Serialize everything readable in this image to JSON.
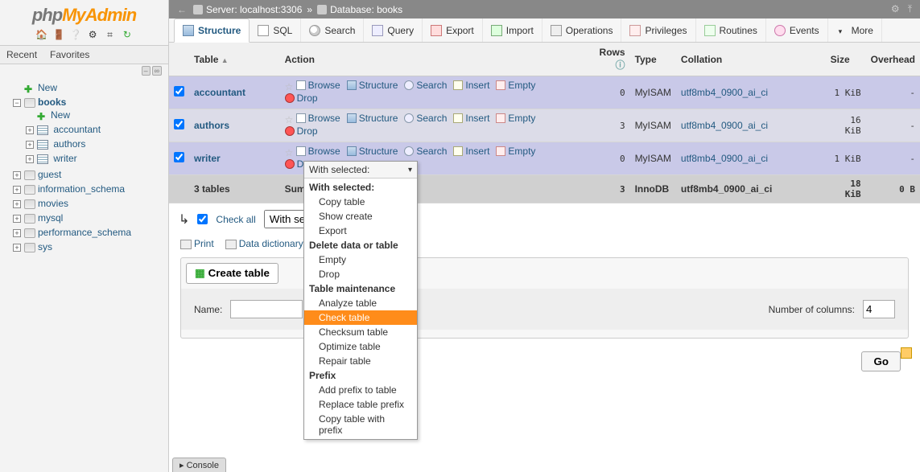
{
  "logo": {
    "p1": "php",
    "p2": "My",
    "p3": "Admin"
  },
  "left_toolbar_icons": [
    "home",
    "logout",
    "docs",
    "gear",
    "gear2",
    "refresh"
  ],
  "recent_fav": {
    "recent": "Recent",
    "favorites": "Favorites"
  },
  "tree": {
    "new_label": "New",
    "databases": [
      {
        "name": "books",
        "expanded": true,
        "selected": true,
        "children": [
          {
            "name": "New",
            "type": "new"
          },
          {
            "name": "accountant",
            "type": "table"
          },
          {
            "name": "authors",
            "type": "table"
          },
          {
            "name": "writer",
            "type": "table"
          }
        ]
      },
      {
        "name": "guest",
        "expanded": false
      },
      {
        "name": "information_schema",
        "expanded": false
      },
      {
        "name": "movies",
        "expanded": false
      },
      {
        "name": "mysql",
        "expanded": false
      },
      {
        "name": "performance_schema",
        "expanded": false
      },
      {
        "name": "sys",
        "expanded": false
      }
    ]
  },
  "breadcrumb": {
    "server_label": "Server: localhost:3306",
    "db_label": "Database: books"
  },
  "topmenu": [
    {
      "key": "structure",
      "label": "Structure",
      "active": true
    },
    {
      "key": "sql",
      "label": "SQL"
    },
    {
      "key": "search",
      "label": "Search"
    },
    {
      "key": "query",
      "label": "Query"
    },
    {
      "key": "export",
      "label": "Export"
    },
    {
      "key": "import",
      "label": "Import"
    },
    {
      "key": "operations",
      "label": "Operations"
    },
    {
      "key": "privileges",
      "label": "Privileges"
    },
    {
      "key": "routines",
      "label": "Routines"
    },
    {
      "key": "events",
      "label": "Events"
    },
    {
      "key": "more",
      "label": "More"
    }
  ],
  "table_headers": {
    "table": "Table",
    "action": "Action",
    "rows": "Rows",
    "type": "Type",
    "collation": "Collation",
    "size": "Size",
    "overhead": "Overhead"
  },
  "row_actions": {
    "browse": "Browse",
    "structure": "Structure",
    "search": "Search",
    "insert": "Insert",
    "empty": "Empty",
    "drop": "Drop"
  },
  "tables": [
    {
      "name": "accountant",
      "rows": "0",
      "type": "MyISAM",
      "collation": "utf8mb4_0900_ai_ci",
      "size": "1 KiB",
      "overhead": "-",
      "checked": true,
      "sel": true
    },
    {
      "name": "authors",
      "rows": "3",
      "type": "MyISAM",
      "collation": "utf8mb4_0900_ai_ci",
      "size": "16 KiB",
      "overhead": "-",
      "checked": true,
      "sel": false
    },
    {
      "name": "writer",
      "rows": "0",
      "type": "MyISAM",
      "collation": "utf8mb4_0900_ai_ci",
      "size": "1 KiB",
      "overhead": "-",
      "checked": true,
      "sel": true
    }
  ],
  "summary": {
    "label": "3 tables",
    "sum": "Sum",
    "rows": "3",
    "type": "InnoDB",
    "collation": "utf8mb4_0900_ai_ci",
    "size": "18 KiB",
    "overhead": "0 B"
  },
  "checkall": {
    "label": "Check all",
    "with_selected": "With selected:"
  },
  "print": "Print",
  "datadict": "Data dictionary",
  "create": {
    "button": "Create table",
    "name_label": "Name:",
    "name_value": "",
    "cols_label": "Number of columns:",
    "cols_value": "4"
  },
  "go": "Go",
  "dropdown": {
    "selector": "With selected:",
    "groups": [
      {
        "header": "With selected:",
        "items": [
          "Copy table",
          "Show create",
          "Export"
        ]
      },
      {
        "header": "Delete data or table",
        "items": [
          "Empty",
          "Drop"
        ]
      },
      {
        "header": "Table maintenance",
        "items": [
          "Analyze table",
          "Check table",
          "Checksum table",
          "Optimize table",
          "Repair table"
        ],
        "highlight": "Check table"
      },
      {
        "header": "Prefix",
        "items": [
          "Add prefix to table",
          "Replace table prefix",
          "Copy table with prefix"
        ]
      }
    ]
  },
  "console": "Console"
}
